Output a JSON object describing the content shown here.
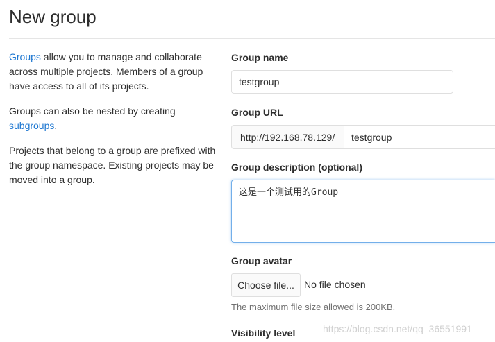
{
  "page": {
    "title": "New group"
  },
  "help": {
    "p1_link": "Groups",
    "p1_text": " allow you to manage and collaborate across multiple projects. Members of a group have access to all of its projects.",
    "p2_text": "Groups can also be nested by creating ",
    "p2_link": "subgroups",
    "p2_end": ".",
    "p3_text": "Projects that belong to a group are prefixed with the group namespace. Existing projects may be moved into a group."
  },
  "form": {
    "group_name": {
      "label": "Group name",
      "value": "testgroup"
    },
    "group_url": {
      "label": "Group URL",
      "prefix": "http://192.168.78.129/",
      "value": "testgroup"
    },
    "description": {
      "label": "Group description (optional)",
      "value": "这是一个测试用的Group"
    },
    "avatar": {
      "label": "Group avatar",
      "button_label": "Choose file...",
      "status": "No file chosen",
      "hint": "The maximum file size allowed is 200KB."
    },
    "visibility": {
      "label": "Visibility level"
    }
  },
  "watermark": "https://blog.csdn.net/qq_36551991",
  "colors": {
    "link": "#1f78d1",
    "focus_border": "#73afea",
    "border": "#dfdfdf"
  }
}
